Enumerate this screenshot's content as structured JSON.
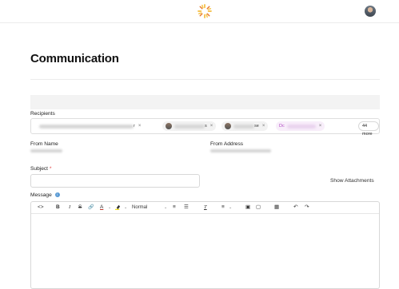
{
  "header": {
    "logo": "sunburst-logo-icon",
    "avatar": "user-avatar"
  },
  "page": {
    "title": "Communication"
  },
  "form": {
    "recipients_label": "Recipients",
    "chips": [
      {
        "suffix": "r",
        "x": "×"
      },
      {
        "suffix": "s",
        "x": "×"
      },
      {
        "suffix": "se",
        "x": "×"
      },
      {
        "prefix": "Dc",
        "x": "×"
      }
    ],
    "more_label": "44 more",
    "from_name_label": "From Name",
    "from_address_label": "From Address",
    "subject_label": "Subject",
    "required_mark": "*",
    "show_attachments": "Show Attachments",
    "message_label": "Message",
    "info_glyph": "i"
  },
  "toolbar": {
    "code": "<>",
    "bold": "B",
    "italic": "I",
    "strike": "S",
    "link": "🔗",
    "text_color": "A",
    "style_select": "Normal",
    "ordered_list": "≡",
    "bullet_list": "☰",
    "clear_format": "T",
    "align": "≡",
    "image": "▣",
    "file": "▢",
    "table": "▦",
    "undo": "↶",
    "redo": "↷",
    "caret": "⌄"
  },
  "colors": {
    "accent_pink": "#b047c2",
    "required": "#e23b3b",
    "info": "#5b9bd5"
  }
}
